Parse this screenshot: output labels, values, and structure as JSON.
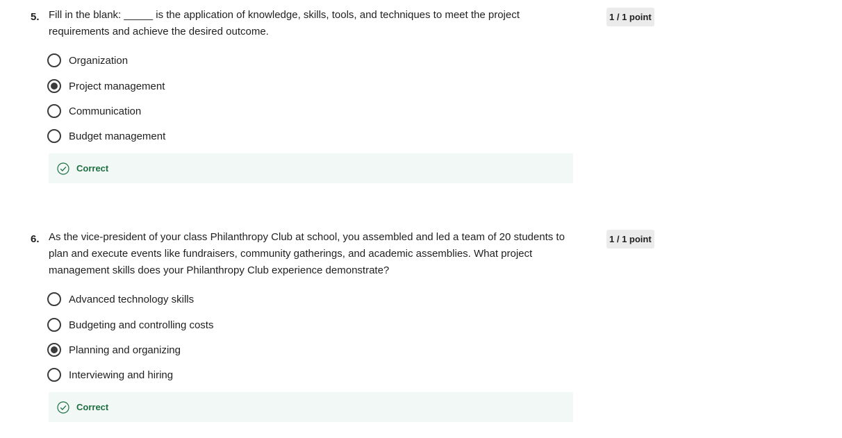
{
  "questions": [
    {
      "number": "5.",
      "text": "Fill in the blank: _____ is the application of knowledge, skills, tools, and techniques to meet the project requirements and achieve the desired outcome.",
      "points": "1 / 1 point",
      "options": [
        {
          "label": "Organization",
          "selected": false
        },
        {
          "label": "Project management",
          "selected": true
        },
        {
          "label": "Communication",
          "selected": false
        },
        {
          "label": "Budget management",
          "selected": false
        }
      ],
      "feedback": "Correct"
    },
    {
      "number": "6.",
      "text": "As the vice-president of your class Philanthropy Club at school, you assembled and led a team of 20 students to plan and execute events like fundraisers, community gatherings, and academic assemblies. What project management skills does your Philanthropy Club experience demonstrate?",
      "points": "1 / 1 point",
      "options": [
        {
          "label": "Advanced technology skills",
          "selected": false
        },
        {
          "label": "Budgeting and controlling costs",
          "selected": false
        },
        {
          "label": "Planning and organizing",
          "selected": true
        },
        {
          "label": "Interviewing and hiring",
          "selected": false
        }
      ],
      "feedback": "Correct"
    }
  ],
  "icons": {
    "radio": "radio-icon",
    "feedback": "check-circle-icon"
  },
  "colors": {
    "correct_text": "#1d6f42",
    "feedback_bg": "#f2f8f5",
    "badge_bg": "#ebebeb"
  }
}
